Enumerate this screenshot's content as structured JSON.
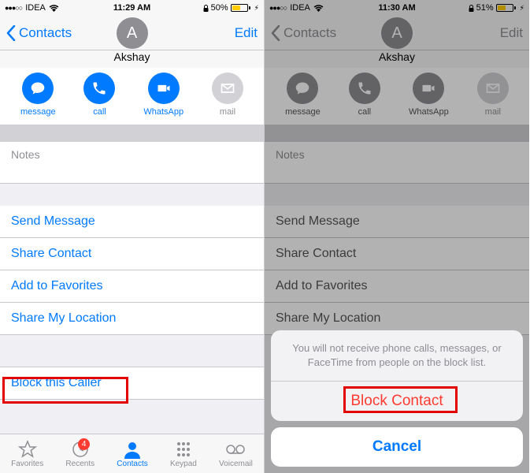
{
  "left": {
    "status": {
      "carrier": "IDEA",
      "time": "11:29 AM",
      "battery_pct": "50%"
    },
    "nav": {
      "back": "Contacts",
      "edit": "Edit"
    },
    "contact": {
      "initial": "A",
      "name": "Akshay"
    },
    "actions": {
      "message": "message",
      "call": "call",
      "whatsapp": "WhatsApp",
      "mail": "mail"
    },
    "notes_label": "Notes",
    "items": [
      "Send Message",
      "Share Contact",
      "Add to Favorites",
      "Share My Location"
    ],
    "block": "Block this Caller",
    "tabs": {
      "favorites": "Favorites",
      "recents": "Recents",
      "recents_badge": "4",
      "contacts": "Contacts",
      "keypad": "Keypad",
      "voicemail": "Voicemail"
    }
  },
  "right": {
    "status": {
      "carrier": "IDEA",
      "time": "11:30 AM",
      "battery_pct": "51%"
    },
    "nav": {
      "back": "Contacts",
      "edit": "Edit"
    },
    "contact": {
      "initial": "A",
      "name": "Akshay"
    },
    "actions": {
      "message": "message",
      "call": "call",
      "whatsapp": "WhatsApp",
      "mail": "mail"
    },
    "notes_label": "Notes",
    "items": [
      "Send Message",
      "Share Contact",
      "Add to Favorites",
      "Share My Location"
    ],
    "sheet": {
      "message": "You will not receive phone calls, messages, or FaceTime from people on the block list.",
      "block": "Block Contact",
      "cancel": "Cancel"
    }
  }
}
